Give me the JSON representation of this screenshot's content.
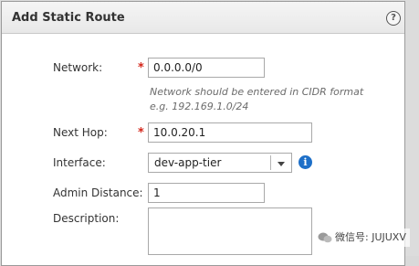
{
  "dialog": {
    "title": "Add Static Route",
    "help": "?"
  },
  "form": {
    "required_mark": "*",
    "network": {
      "label": "Network:",
      "value": "0.0.0.0/0",
      "hint_line1": "Network should be entered in CIDR format",
      "hint_line2": "e.g. 192.169.1.0/24"
    },
    "next_hop": {
      "label": "Next Hop:",
      "value": "10.0.20.1"
    },
    "interface": {
      "label": "Interface:",
      "selected": "dev-app-tier",
      "info": "i"
    },
    "admin_distance": {
      "label": "Admin Distance:",
      "value": "1"
    },
    "description": {
      "label": "Description:",
      "value": ""
    }
  },
  "watermark": {
    "text": "微信号: JUJUXV"
  },
  "colors": {
    "required": "#d4261a",
    "info": "#1d6fc8"
  }
}
